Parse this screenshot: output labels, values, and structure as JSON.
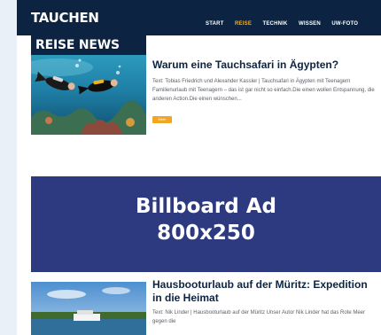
{
  "site": {
    "logo": "TAUCHEN"
  },
  "nav": {
    "items": [
      {
        "label": "START",
        "active": false
      },
      {
        "label": "REISE",
        "active": true
      },
      {
        "label": "TECHNIK",
        "active": false
      },
      {
        "label": "WISSEN",
        "active": false
      },
      {
        "label": "UW-FOTO",
        "active": false
      }
    ]
  },
  "articles": [
    {
      "category": "REISE NEWS",
      "title": "Warum eine Tauchsafari in Ägypten?",
      "teaser": "Text: Tobias Friedrich und Alexander Kassler | Tauchsafari in Ägypten mit Teenagern Familienurlaub mit Teenagern – das ist gar nicht so einfach.Die einen wollen Entspannung, die anderen Action.Die einen wünschen...",
      "button_label": "Mehr"
    },
    {
      "title": "Hausbooturlaub auf der Müritz: Expedition in die Heimat",
      "teaser": "Text: Nik Linder | Hausbooturlaub auf der Müritz Unser Autor Nik Linder hat das Rote Meer gegen die"
    }
  ],
  "ad": {
    "line1": "Billboard Ad",
    "line2": "800x250"
  },
  "colors": {
    "navy": "#0c2341",
    "accent": "#f2b21f",
    "button": "#f2a625",
    "ad_background": "#2d3a80",
    "side_background": "#e9f0f8"
  },
  "icons": {
    "article_1_image": "divers-underwater-photo",
    "article_2_image": "lake-houseboat-photo"
  }
}
